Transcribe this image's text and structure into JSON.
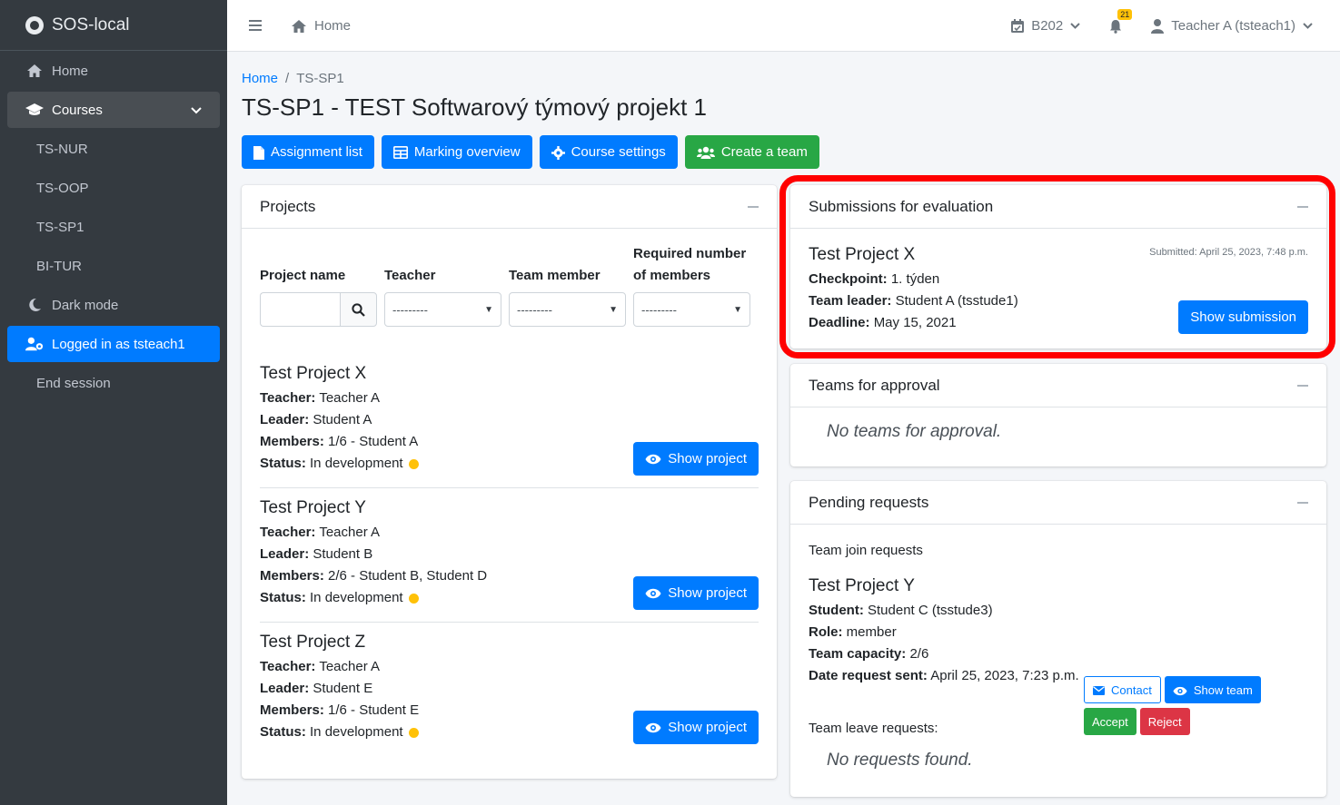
{
  "brand": {
    "title": "SOS-local"
  },
  "sidebar": {
    "home": "Home",
    "courses": "Courses",
    "course_items": [
      "TS-NUR",
      "TS-OOP",
      "TS-SP1",
      "BI-TUR"
    ],
    "dark_mode": "Dark mode",
    "logged_in": "Logged in as tsteach1",
    "end_session": "End session"
  },
  "topbar": {
    "home": "Home",
    "room": "B202",
    "notifications_count": "21",
    "user": "Teacher A (tsteach1)"
  },
  "breadcrumb": {
    "home": "Home",
    "current": "TS-SP1"
  },
  "page_title": "TS-SP1 - TEST Softwarový týmový projekt 1",
  "actions": {
    "assignment_list": "Assignment list",
    "marking_overview": "Marking overview",
    "course_settings": "Course settings",
    "create_team": "Create a team"
  },
  "projects_card": {
    "title": "Projects",
    "filters": {
      "project_name": "Project name",
      "teacher": "Teacher",
      "team_member": "Team member",
      "required_members": "Required number of members",
      "placeholder": "---------"
    },
    "labels": {
      "teacher": "Teacher:",
      "leader": "Leader:",
      "members": "Members:",
      "status": "Status:"
    },
    "show_project": "Show project",
    "projects": [
      {
        "name": "Test Project X",
        "teacher": "Teacher A",
        "leader": "Student A",
        "members": "1/6 - Student A",
        "status": "In development"
      },
      {
        "name": "Test Project Y",
        "teacher": "Teacher A",
        "leader": "Student B",
        "members": "2/6 - Student B, Student D",
        "status": "In development"
      },
      {
        "name": "Test Project Z",
        "teacher": "Teacher A",
        "leader": "Student E",
        "members": "1/6 - Student E",
        "status": "In development"
      }
    ]
  },
  "submissions_card": {
    "title": "Submissions for evaluation",
    "project": "Test Project X",
    "submitted": "Submitted: April 25, 2023, 7:48 p.m.",
    "checkpoint_label": "Checkpoint:",
    "checkpoint": "1. týden",
    "leader_label": "Team leader:",
    "leader": "Student A (tsstude1)",
    "deadline_label": "Deadline:",
    "deadline": "May 15, 2021",
    "show_submission": "Show submission"
  },
  "teams_card": {
    "title": "Teams for approval",
    "empty": "No teams for approval."
  },
  "pending_card": {
    "title": "Pending requests",
    "join_title": "Team join requests",
    "project": "Test Project Y",
    "student_label": "Student:",
    "student": "Student C (tsstude3)",
    "role_label": "Role:",
    "role": "member",
    "capacity_label": "Team capacity:",
    "capacity": "2/6",
    "date_label": "Date request sent:",
    "date": "April 25, 2023, 7:23 p.m.",
    "contact": "Contact",
    "show_team": "Show team",
    "accept": "Accept",
    "reject": "Reject",
    "leave_title": "Team leave requests:",
    "leave_empty": "No requests found."
  },
  "colors": {
    "primary": "#007bff",
    "success": "#28a745",
    "danger": "#dc3545",
    "warning": "#ffc107",
    "sidebar": "#343a40",
    "highlight": "#ff0000"
  }
}
